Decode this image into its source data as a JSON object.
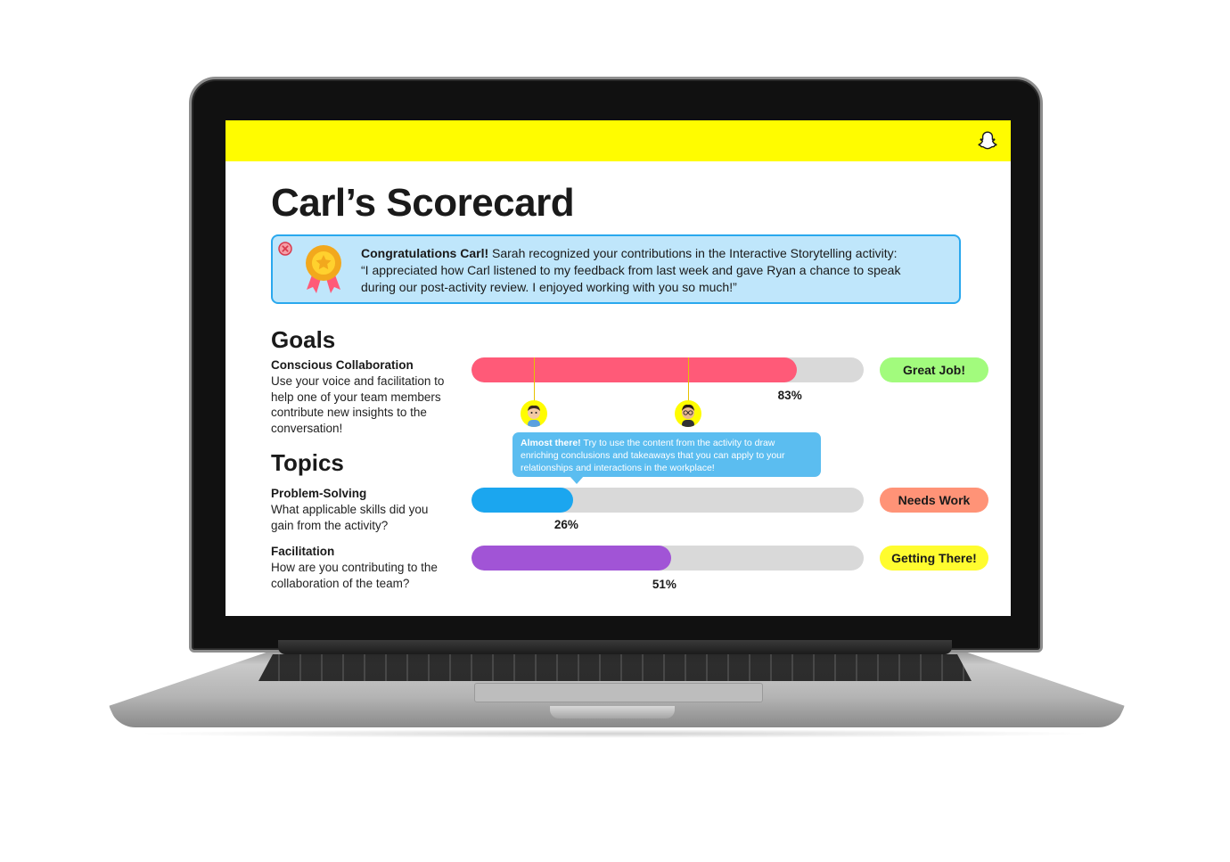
{
  "page": {
    "title": "Carl’s Scorecard",
    "brand_icon": "snapchat-ghost-icon",
    "accent_color": "#fffc00"
  },
  "banner": {
    "close_icon": "close-circle-icon",
    "medal_icon": "award-medal-icon",
    "lead": "Congratulations Carl!",
    "text": " Sarah recognized your contributions in the Interactive Storytelling activity:",
    "quote": "“I appreciated how Carl listened to my feedback from last week and gave Ryan a chance to speak during our post-activity review. I enjoyed working with you so much!”"
  },
  "goals": {
    "heading": "Goals",
    "items": [
      {
        "title": "Conscious Collaboration",
        "description": "Use your voice and facilitation to help one of your team members contribute new insights to the conversation!",
        "percent": 83,
        "percent_label": "83%",
        "bar_color": "#ff5a78",
        "badge": "Great Job!",
        "badge_color": "#a2fb7d"
      }
    ]
  },
  "topics": {
    "heading": "Topics",
    "items": [
      {
        "title": "Problem-Solving",
        "description": "What applicable skills did you gain from the activity?",
        "percent": 26,
        "percent_label": "26%",
        "bar_color": "#1ba6ef",
        "badge": "Needs Work",
        "badge_color": "#ff9377"
      },
      {
        "title": "Facilitation",
        "description": "How are you contributing to the collaboration of the team?",
        "percent": 51,
        "percent_label": "51%",
        "bar_color": "#a154d6",
        "badge": "Getting There!",
        "badge_color": "#fffc2f"
      }
    ]
  },
  "markers": [
    {
      "icon": "avatar-icon"
    },
    {
      "icon": "avatar-icon"
    }
  ],
  "tooltip": {
    "lead": "Almost there!",
    "text": " Try to use the content from the activity to draw enriching conclusions and takeaways that you can apply to your relationships and interactions in the workplace!"
  }
}
